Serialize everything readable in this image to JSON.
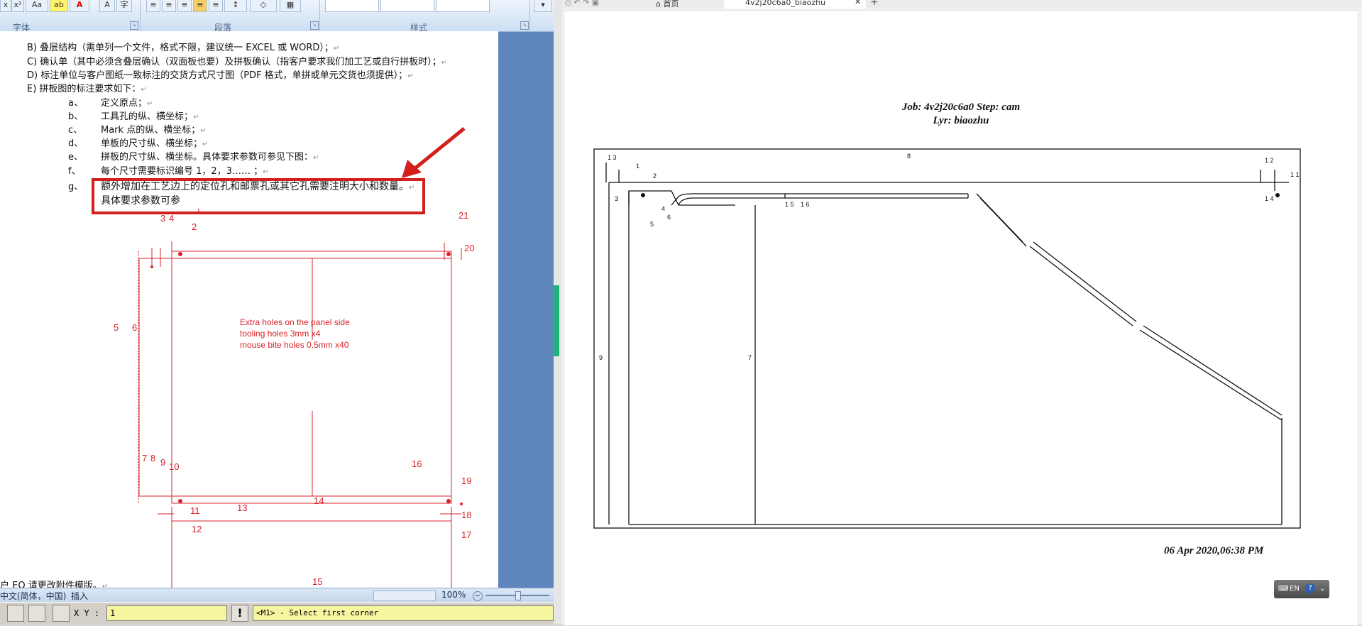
{
  "ribbon": {
    "groups": [
      {
        "label": "字体"
      },
      {
        "label": "段落"
      },
      {
        "label": "样式"
      }
    ],
    "font_size_label": "Aa"
  },
  "document": {
    "lines": [
      "B) 叠层结构（需单列一个文件，格式不限，建议统一 EXCEL 或 WORD）；",
      "C) 确认单（其中必须含叠层确认（双面板也要）及拼板确认（指客户要求我们加工艺或自行拼板时）；",
      "D) 标注单位与客户图纸一致标注的交货方式尺寸图（PDF 格式，单拼或单元交货也须提供）；",
      "E) 拼板图的标注要求如下："
    ],
    "sub_items": [
      {
        "letter": "a、",
        "text": "定义原点；"
      },
      {
        "letter": "b、",
        "text": "工具孔的纵、横坐标；"
      },
      {
        "letter": "c、",
        "text": "Mark 点的纵、横坐标；"
      },
      {
        "letter": "d、",
        "text": "单板的尺寸纵、横坐标；"
      },
      {
        "letter": "e、",
        "text": "拼板的尺寸纵、横坐标。具体要求参数可参见下图："
      },
      {
        "letter": "f、",
        "text": "每个尺寸需要标识编号 1，2，3…… ；"
      },
      {
        "letter": "g、",
        "text": "额外增加在工艺边上的定位孔和邮票孔或其它孔需要注明大小和数量。"
      }
    ],
    "continuation": "具体要求参数可参",
    "bottom_line": "户 EQ 请更改附件模版。",
    "drawing": {
      "note_lines": [
        "Extra holes on the panel side",
        "tooling holes 3mm x4",
        "mouse bite holes 0.5mm x40"
      ],
      "callouts": [
        "1",
        "2",
        "3",
        "4",
        "5",
        "6",
        "7",
        "8",
        "9",
        "10",
        "11",
        "12",
        "13",
        "14",
        "15",
        "16",
        "17",
        "18",
        "19",
        "20",
        "21"
      ]
    }
  },
  "statusbar": {
    "language": "中文(简体，中国)",
    "mode": "插入",
    "zoom": "100%"
  },
  "cad": {
    "xy_label": "X Y :",
    "xy_value": "1",
    "prompt": "<M1> - Select first corner"
  },
  "viewer": {
    "tab_home": "首页",
    "tab_doc": "4v2j20c6a0_biaozhu",
    "title_line1": "Job: 4v2j20c6a0  Step: cam",
    "title_line2": "Lyr: biaozhu",
    "timestamp": "06 Apr 2020,06:38 PM",
    "ime_label": "EN"
  }
}
